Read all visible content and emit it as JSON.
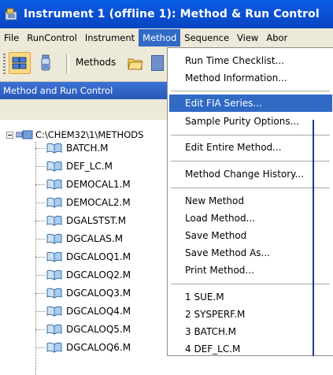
{
  "window": {
    "title": "Instrument 1 (offline 1): Method & Run Control"
  },
  "menubar": {
    "items": [
      "File",
      "RunControl",
      "Instrument",
      "Method",
      "Sequence",
      "View",
      "Abor"
    ]
  },
  "toolbar": {
    "methods_label": "Methods"
  },
  "panel": {
    "title": "Method and Run Control",
    "root": "C:\\CHEM32\\1\\METHODS",
    "files": [
      "BATCH.M",
      "DEF_LC.M",
      "DEMOCAL1.M",
      "DEMOCAL2.M",
      "DGALSTST.M",
      "DGCALAS.M",
      "DGCALOQ1.M",
      "DGCALOQ2.M",
      "DGCALOQ3.M",
      "DGCALOQ4.M",
      "DGCALOQ5.M",
      "DGCALOQ6.M"
    ]
  },
  "method_menu": {
    "items": [
      "Run Time Checklist...",
      "Method Information...",
      "Edit FIA Series...",
      "Sample Purity Options...",
      "Edit Entire Method...",
      "Method Change History...",
      "New Method",
      "Load Method...",
      "Save Method",
      "Save Method As...",
      "Print Method...",
      "1 SUE.M",
      "2 SYSPERF.M",
      "3 BATCH.M",
      "4 DEF_LC.M"
    ],
    "highlighted": "Edit FIA Series..."
  },
  "colors": {
    "title_bar": "#0a52d6",
    "selection": "#316ac5",
    "menu_bg": "#ece9d8"
  }
}
